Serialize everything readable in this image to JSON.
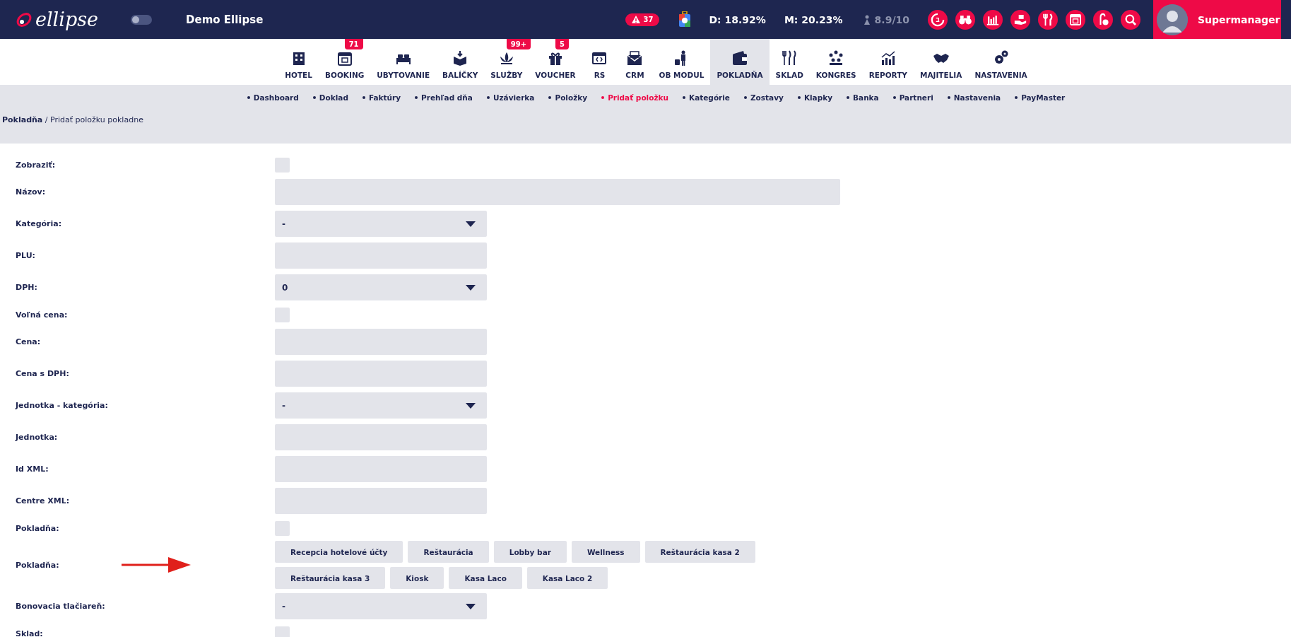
{
  "top_bar": {
    "logo": "ellipse",
    "hotel_name": "Demo Ellipse",
    "alert_count": "37",
    "stat_d": "D: 18.92%",
    "stat_m": "M: 20.23%",
    "rating": "8.9/10",
    "user_name": "Supermanager",
    "toggle_on": false
  },
  "main_nav": [
    {
      "label": "HOTEL",
      "selected": false
    },
    {
      "label": "BOOKING",
      "badge": "71",
      "selected": false
    },
    {
      "label": "UBYTOVANIE",
      "selected": false
    },
    {
      "label": "BALÍČKY",
      "selected": false
    },
    {
      "label": "SLUŽBY",
      "badge": "99+",
      "selected": false
    },
    {
      "label": "VOUCHER",
      "badge": "5",
      "selected": false
    },
    {
      "label": "RS",
      "selected": false
    },
    {
      "label": "CRM",
      "selected": false
    },
    {
      "label": "OB MODUL",
      "selected": false
    },
    {
      "label": "POKLADŇA",
      "selected": true
    },
    {
      "label": "SKLAD",
      "selected": false
    },
    {
      "label": "KONGRES",
      "selected": false
    },
    {
      "label": "REPORTY",
      "selected": false
    },
    {
      "label": "MAJITELIA",
      "selected": false
    },
    {
      "label": "NASTAVENIA",
      "selected": false
    }
  ],
  "sub_nav": [
    {
      "label": "Dashboard",
      "selected": false
    },
    {
      "label": "Doklad",
      "selected": false
    },
    {
      "label": "Faktúry",
      "selected": false
    },
    {
      "label": "Prehľad dňa",
      "selected": false
    },
    {
      "label": "Uzávierka",
      "selected": false
    },
    {
      "label": "Položky",
      "selected": false
    },
    {
      "label": "Pridať položku",
      "selected": true
    },
    {
      "label": "Kategórie",
      "selected": false
    },
    {
      "label": "Zostavy",
      "selected": false
    },
    {
      "label": "Klapky",
      "selected": false
    },
    {
      "label": "Banka",
      "selected": false
    },
    {
      "label": "Partneri",
      "selected": false
    },
    {
      "label": "Nastavenia",
      "selected": false
    },
    {
      "label": "PayMaster",
      "selected": false
    }
  ],
  "breadcrumb": {
    "parent": "Pokladňa",
    "current": "/ Pridať položku pokladne"
  },
  "form": [
    {
      "kind": "checkbox",
      "label": "Zobraziť:",
      "checked": false
    },
    {
      "kind": "text",
      "label": "Názov:",
      "wide": true
    },
    {
      "kind": "select",
      "label": "Kategória:",
      "value": "-"
    },
    {
      "kind": "text",
      "label": "PLU:"
    },
    {
      "kind": "select",
      "label": "DPH:",
      "value": "0"
    },
    {
      "kind": "checkbox",
      "label": "Voľná cena:",
      "checked": false
    },
    {
      "kind": "text",
      "label": "Cena:"
    },
    {
      "kind": "text",
      "label": "Cena s DPH:"
    },
    {
      "kind": "select",
      "label": "Jednotka - kategória:",
      "value": "-"
    },
    {
      "kind": "text",
      "label": "Jednotka:"
    },
    {
      "kind": "text",
      "label": "Id XML:"
    },
    {
      "kind": "text",
      "label": "Centre XML:"
    },
    {
      "kind": "checkbox",
      "label": "Pokladňa:",
      "checked": false
    },
    {
      "kind": "buttons",
      "label": "Pokladňa:",
      "arrow": true,
      "options": [
        "Recepcia hotelové účty",
        "Reštaurácia",
        "Lobby bar",
        "Wellness",
        "Reštaurácia kasa 2",
        "Reštaurácia kasa 3",
        "Kiosk",
        "Kasa Laco",
        "Kasa Laco 2"
      ]
    },
    {
      "kind": "select",
      "label": "Bonovacia tlačiareň:",
      "value": "-"
    },
    {
      "kind": "checkbox",
      "label": "Sklad:",
      "checked": false
    }
  ]
}
